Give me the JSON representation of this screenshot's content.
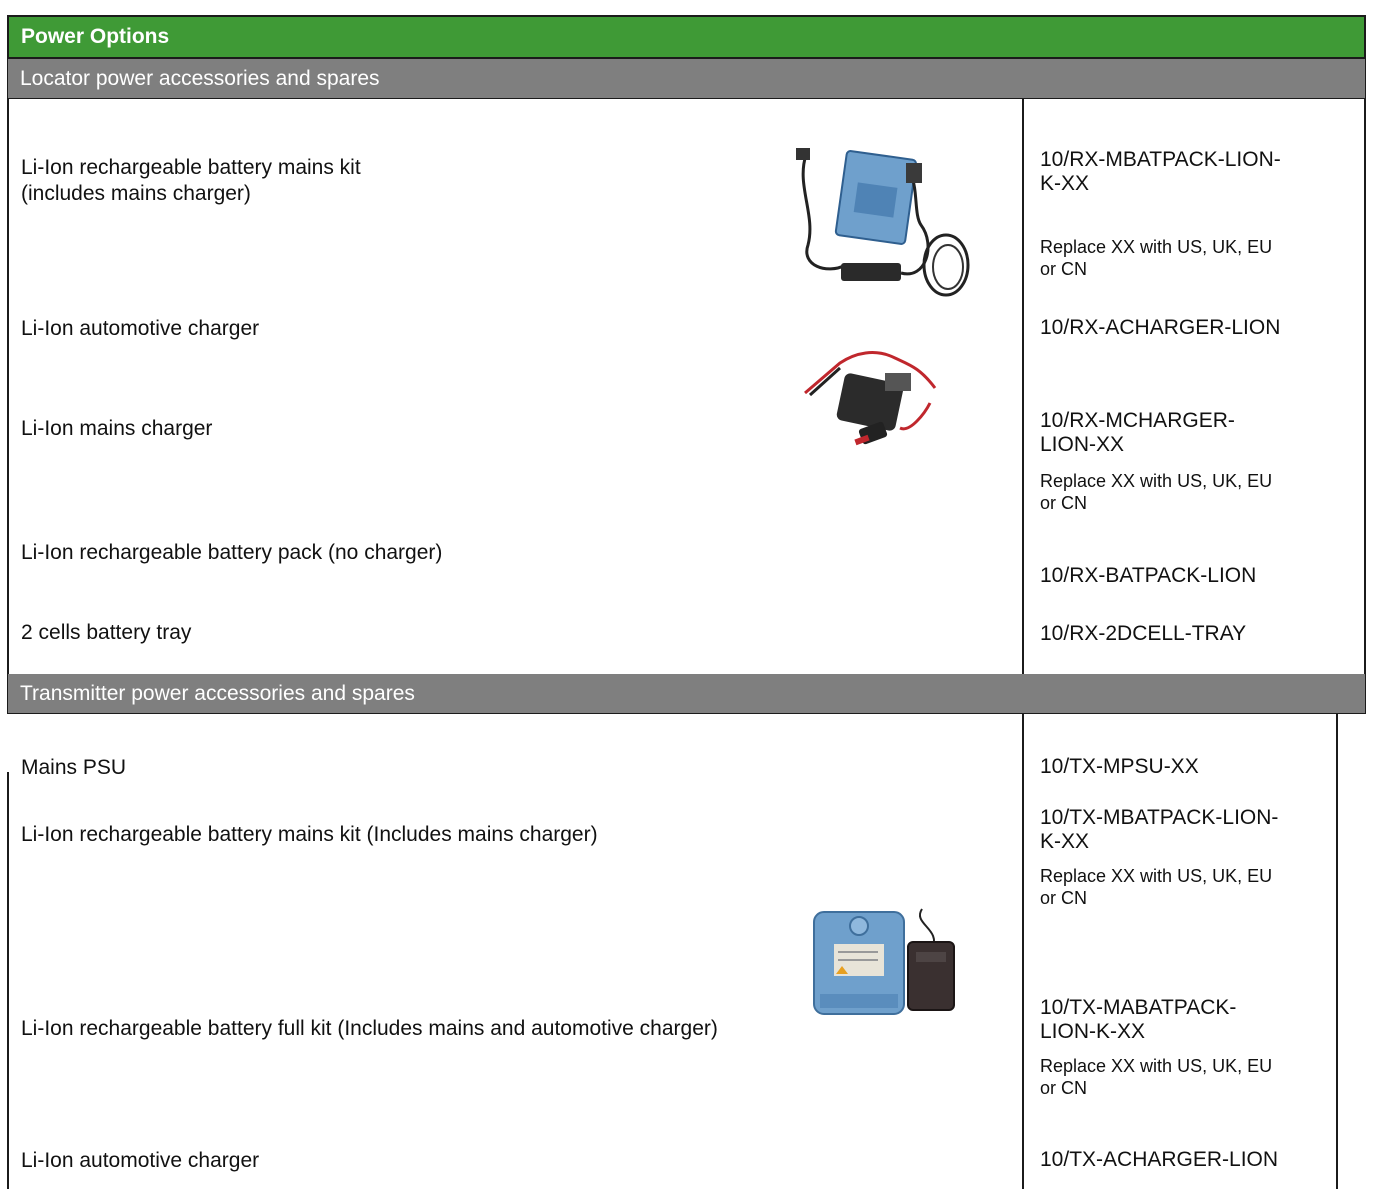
{
  "header": {
    "title": "Power Options"
  },
  "locator": {
    "section_title": "Locator power accessories and spares",
    "rows": [
      {
        "desc_line1": "Li-Ion rechargeable battery mains kit",
        "desc_line2": "(includes mains charger)",
        "code_line1": "10/RX-MBATPACK-LION-",
        "code_line2": "K-XX",
        "note_line1": "Replace XX with US, UK, EU",
        "note_line2": "or CN"
      },
      {
        "desc": "Li-Ion automotive charger",
        "code": "10/RX-ACHARGER-LION"
      },
      {
        "desc": "Li-Ion mains charger",
        "code_line1": "10/RX-MCHARGER-",
        "code_line2": "LION-XX",
        "note_line1": "Replace XX with US, UK, EU",
        "note_line2": "or CN"
      },
      {
        "desc": "Li-Ion rechargeable battery pack (no charger)",
        "code": "10/RX-BATPACK-LION"
      },
      {
        "desc": "2 cells battery tray",
        "code": "10/RX-2DCELL-TRAY"
      }
    ]
  },
  "transmitter": {
    "section_title": "Transmitter power accessories and spares",
    "rows": [
      {
        "desc": "Mains PSU",
        "code": "10/TX-MPSU-XX"
      },
      {
        "desc": "Li-Ion rechargeable battery mains kit (Includes mains charger)",
        "code_line1": "10/TX-MBATPACK-LION-",
        "code_line2": "K-XX",
        "note_line1": "Replace XX with US, UK, EU",
        "note_line2": "or CN"
      },
      {
        "desc": "Li-Ion rechargeable battery full kit (Includes mains and automotive charger)",
        "code_line1": "10/TX-MABATPACK-",
        "code_line2": "LION-K-XX",
        "note_line1": "Replace XX with US, UK, EU",
        "note_line2": "or CN"
      },
      {
        "desc": "Li-Ion automotive charger",
        "code": "10/TX-ACHARGER-LION"
      }
    ]
  },
  "colors": {
    "header_green": "#3f9a36",
    "section_gray": "#7f7f7f",
    "battery_blue": "#6fa0cc"
  },
  "images": [
    "battery-mains-kit-photo",
    "automotive-charger-photo",
    "tx-battery-charger-photo"
  ]
}
